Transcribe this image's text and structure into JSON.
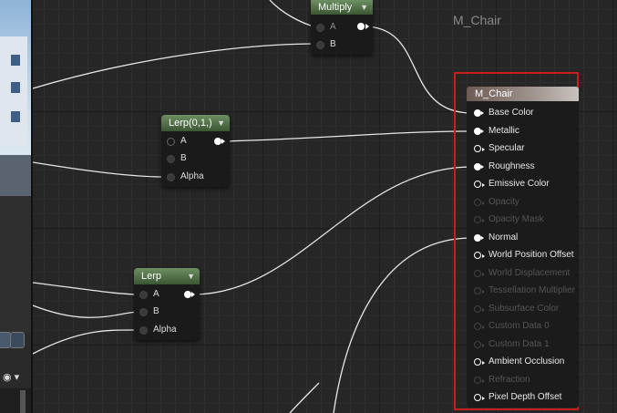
{
  "graph": {
    "title": "M_Chair"
  },
  "nodes": {
    "multiply": {
      "title": "Multiply",
      "inputs": [
        "A",
        "B"
      ]
    },
    "lerp1": {
      "title": "Lerp(0,1,)",
      "inputs": [
        "A",
        "B",
        "Alpha"
      ]
    },
    "lerp2": {
      "title": "Lerp",
      "inputs": [
        "A",
        "B",
        "Alpha"
      ]
    }
  },
  "result": {
    "title": "M_Chair",
    "pins": [
      {
        "label": "Base Color",
        "state": "connected"
      },
      {
        "label": "Metallic",
        "state": "connected"
      },
      {
        "label": "Specular",
        "state": "enabled"
      },
      {
        "label": "Roughness",
        "state": "connected"
      },
      {
        "label": "Emissive Color",
        "state": "enabled"
      },
      {
        "label": "Opacity",
        "state": "disabled"
      },
      {
        "label": "Opacity Mask",
        "state": "disabled"
      },
      {
        "label": "Normal",
        "state": "connected"
      },
      {
        "label": "World Position Offset",
        "state": "enabled"
      },
      {
        "label": "World Displacement",
        "state": "disabled"
      },
      {
        "label": "Tessellation Multiplier",
        "state": "disabled"
      },
      {
        "label": "Subsurface Color",
        "state": "disabled"
      },
      {
        "label": "Custom Data 0",
        "state": "disabled"
      },
      {
        "label": "Custom Data 1",
        "state": "disabled"
      },
      {
        "label": "Ambient Occlusion",
        "state": "enabled"
      },
      {
        "label": "Refraction",
        "state": "disabled"
      },
      {
        "label": "Pixel Depth Offset",
        "state": "enabled"
      }
    ]
  },
  "viewport": {
    "visibility_icon": "eye-icon"
  },
  "colors": {
    "highlight_frame": "#c81e1e",
    "node_header": "#4f6e45",
    "wire": "#e6e6e6"
  }
}
